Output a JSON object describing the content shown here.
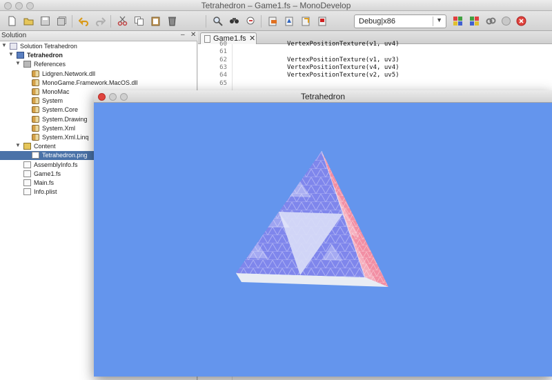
{
  "window": {
    "title": "Tetrahedron – Game1.fs – MonoDevelop"
  },
  "toolbar": {
    "buttons": [
      "new-file",
      "open-file",
      "save",
      "save-all",
      "undo",
      "redo",
      "cut",
      "copy",
      "paste",
      "delete",
      "find",
      "find-in-files",
      "replace",
      "build",
      "build-all",
      "rebuild",
      "clean",
      "run",
      "debug",
      "attach",
      "stop"
    ],
    "configuration": "Debug|x86"
  },
  "solution_pad": {
    "title": "Solution",
    "tree": [
      {
        "label": "Solution Tetrahedron",
        "level": 0,
        "icon": "solution-icon",
        "expanded": true,
        "bold": false
      },
      {
        "label": "Tetrahedron",
        "level": 1,
        "icon": "project-icon",
        "expanded": true,
        "bold": true
      },
      {
        "label": "References",
        "level": 2,
        "icon": "references-folder-icon",
        "expanded": true,
        "bold": false
      },
      {
        "label": "Lidgren.Network.dll",
        "level": 3,
        "icon": "reference-icon",
        "bold": false
      },
      {
        "label": "MonoGame.Framework.MacOS.dll",
        "level": 3,
        "icon": "reference-icon",
        "bold": false
      },
      {
        "label": "MonoMac",
        "level": 3,
        "icon": "reference-icon",
        "bold": false
      },
      {
        "label": "System",
        "level": 3,
        "icon": "reference-icon",
        "bold": false
      },
      {
        "label": "System.Core",
        "level": 3,
        "icon": "reference-icon",
        "bold": false
      },
      {
        "label": "System.Drawing",
        "level": 3,
        "icon": "reference-icon",
        "bold": false
      },
      {
        "label": "System.Xml",
        "level": 3,
        "icon": "reference-icon",
        "bold": false
      },
      {
        "label": "System.Xml.Linq",
        "level": 3,
        "icon": "reference-icon",
        "bold": false
      },
      {
        "label": "Content",
        "level": 2,
        "icon": "folder-icon",
        "expanded": true,
        "bold": false
      },
      {
        "label": "Tetrahedron.png",
        "level": 3,
        "icon": "png-file-icon",
        "bold": false,
        "selected": true
      },
      {
        "label": "AssemblyInfo.fs",
        "level": 2,
        "icon": "fs-file-icon",
        "bold": false
      },
      {
        "label": "Game1.fs",
        "level": 2,
        "icon": "fs-file-icon",
        "bold": false
      },
      {
        "label": "Main.fs",
        "level": 2,
        "icon": "fs-file-icon",
        "bold": false
      },
      {
        "label": "Info.plist",
        "level": 2,
        "icon": "plist-file-icon",
        "bold": false
      }
    ]
  },
  "editor": {
    "tab_label": "Game1.fs",
    "lines": [
      {
        "n": "60",
        "code": "VertexPositionTexture(v1, uv4)"
      },
      {
        "n": "61",
        "code": ""
      },
      {
        "n": "62",
        "code": "VertexPositionTexture(v1, uv3)"
      },
      {
        "n": "63",
        "code": "VertexPositionTexture(v4, uv4)"
      },
      {
        "n": "64",
        "code": "VertexPositionTexture(v2, uv5)"
      },
      {
        "n": "65",
        "code": ""
      }
    ]
  },
  "game_window": {
    "title": "Tetrahedron",
    "background": "#6495ed",
    "face_colors": {
      "left": "#7f86ec",
      "right": "#f28fa4",
      "bottom": "#e8ecf4",
      "inner": "#d8dcf7"
    }
  },
  "colors": {
    "selection": "#4a72a8",
    "close_red": "#e0443e",
    "minimize_yellow": "#dea236",
    "zoom_green": "#5fa83f"
  }
}
